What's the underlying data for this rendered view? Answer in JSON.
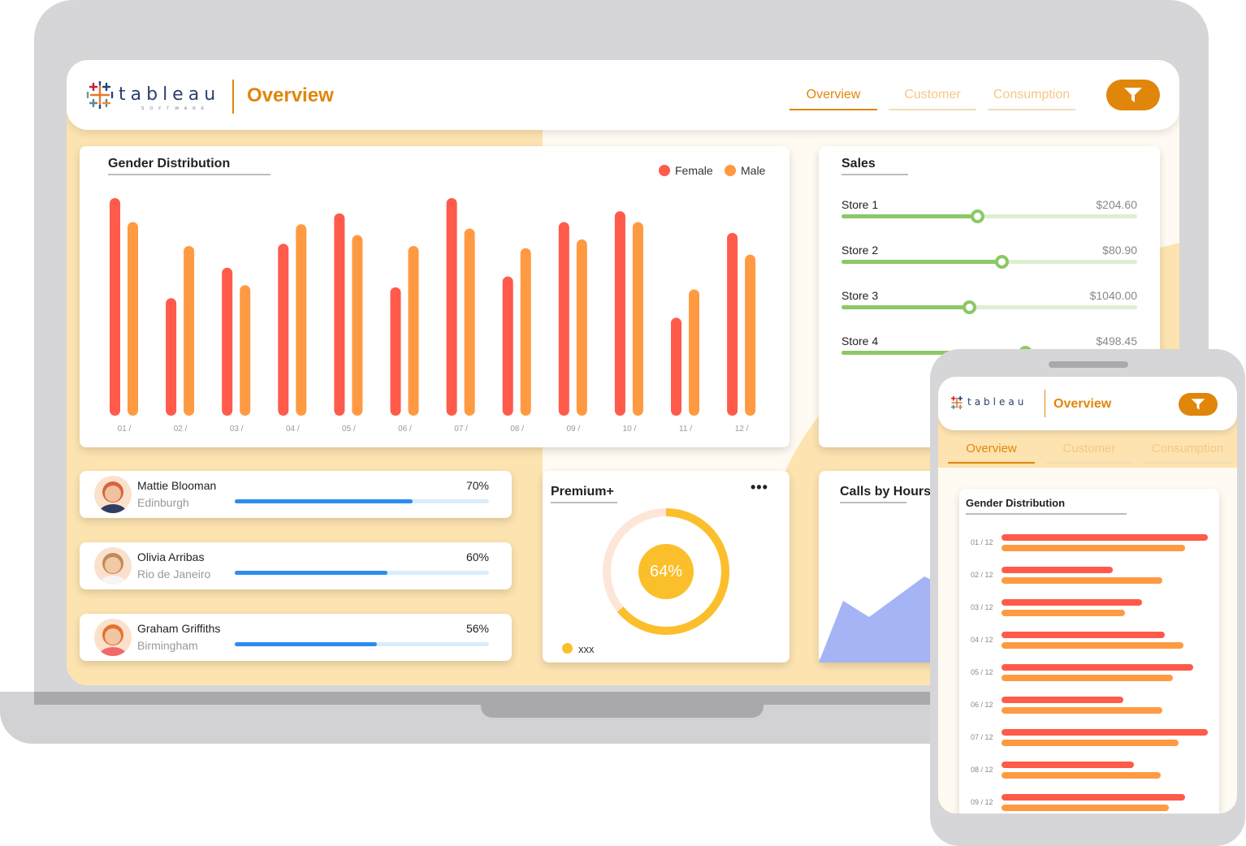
{
  "colors": {
    "female": "#ff5a4a",
    "male": "#ff9a42",
    "accent": "#e0860a",
    "sales": "#8cc865",
    "progress": "#2d8cf0",
    "donut": "#fbbf2b",
    "area": "#a4b4f5"
  },
  "header": {
    "logo_word": "tableau",
    "logo_sub": "SOFTWARE",
    "title": "Overview",
    "tabs": [
      {
        "label": "Overview",
        "active": true
      },
      {
        "label": "Customer",
        "active": false
      },
      {
        "label": "Consumption",
        "active": false
      }
    ],
    "filter_icon": "filter-icon"
  },
  "gender": {
    "title": "Gender Distribution",
    "legend": {
      "female": "Female",
      "male": "Male"
    }
  },
  "chart_data": {
    "type": "bar",
    "title": "Gender Distribution",
    "categories": [
      "01 /",
      "02 /",
      "03 /",
      "04 /",
      "05 /",
      "06 /",
      "07 /",
      "08 /",
      "09 /",
      "10 /",
      "11 /",
      "12 /"
    ],
    "series": [
      {
        "name": "Female",
        "values": [
          100,
          54,
          68,
          79,
          93,
          59,
          100,
          64,
          89,
          94,
          45,
          84
        ]
      },
      {
        "name": "Male",
        "values": [
          89,
          78,
          60,
          88,
          83,
          78,
          86,
          77,
          81,
          89,
          58,
          74
        ]
      }
    ],
    "ylim": [
      0,
      100
    ]
  },
  "sales": {
    "title": "Sales",
    "stores": [
      {
        "name": "Store 1",
        "value": "$204.60",
        "level": 0.46
      },
      {
        "name": "Store 2",
        "value": "$80.90",
        "level": 0.54
      },
      {
        "name": "Store 3",
        "value": "$1040.00",
        "level": 0.43
      },
      {
        "name": "Store 4",
        "value": "$498.45",
        "level": 0.62
      }
    ]
  },
  "people": [
    {
      "name": "Mattie Blooman",
      "city": "Edinburgh",
      "pct": "70%",
      "level": 0.7
    },
    {
      "name": "Olivia Arribas",
      "city": "Rio de Janeiro",
      "pct": "60%",
      "level": 0.6
    },
    {
      "name": "Graham Griffiths",
      "city": "Birmingham",
      "pct": "56%",
      "level": 0.56
    }
  ],
  "premium": {
    "title": "Premium+",
    "value": "64%",
    "level": 0.64,
    "legend": "xxx",
    "menu_icon": "more-dots-icon"
  },
  "calls": {
    "title": "Calls by Hours"
  },
  "phone": {
    "title": "Overview",
    "tabs": [
      {
        "label": "Overview",
        "active": true
      },
      {
        "label": "Customer",
        "active": false
      },
      {
        "label": "Consumption",
        "active": false
      }
    ],
    "chart_title": "Gender Distribution",
    "labels": [
      "01 / 12",
      "02 / 12",
      "03 / 12",
      "04 / 12",
      "05 / 12",
      "06 / 12",
      "07 / 12",
      "08 / 12",
      "09 / 12"
    ]
  }
}
